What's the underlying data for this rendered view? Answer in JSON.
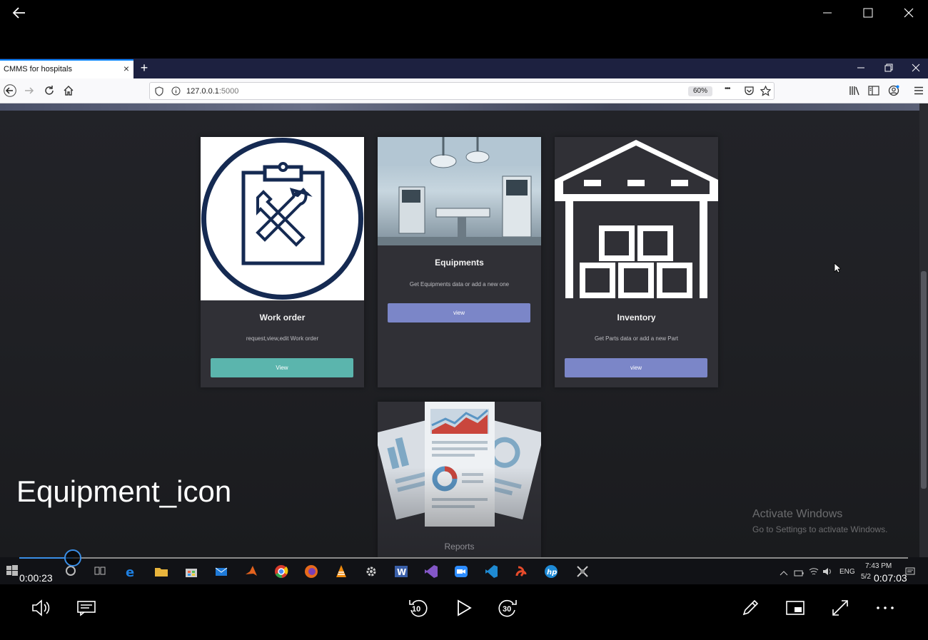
{
  "player": {
    "caption": "Equipment_icon",
    "time_current": "0:00:23",
    "time_total": "0:07:03",
    "progress_fraction": 0.06,
    "rewind_seconds": "10",
    "forward_seconds": "30"
  },
  "browser": {
    "tab_title": "CMMS for hospitals",
    "tab_close": "×",
    "new_tab": "+",
    "url_host": "127.0.0.1",
    "url_port": ":5000",
    "zoom": "60%",
    "more": "•••"
  },
  "cards": [
    {
      "title": "Work order",
      "desc": "request,view,edit Work order",
      "button": "View",
      "button_color": "#5bb5ad"
    },
    {
      "title": "Equipments",
      "desc": "Get Equipments data or add a new one",
      "button": "view",
      "button_color": "#7b86c8"
    },
    {
      "title": "Inventory",
      "desc": "Get Parts data or add a new Part",
      "button": "view",
      "button_color": "#7b86c8"
    },
    {
      "title": "Reports"
    }
  ],
  "watermark": {
    "line1": "Activate Windows",
    "line2": "Go to Settings to activate Windows."
  },
  "tray": {
    "lang": "ENG",
    "time": "7:43 PM",
    "date": "5/2"
  },
  "colors": {
    "accent": "#3a8ee6",
    "tab_accent": "#0a84ff",
    "navy_icon": "#152a52"
  }
}
